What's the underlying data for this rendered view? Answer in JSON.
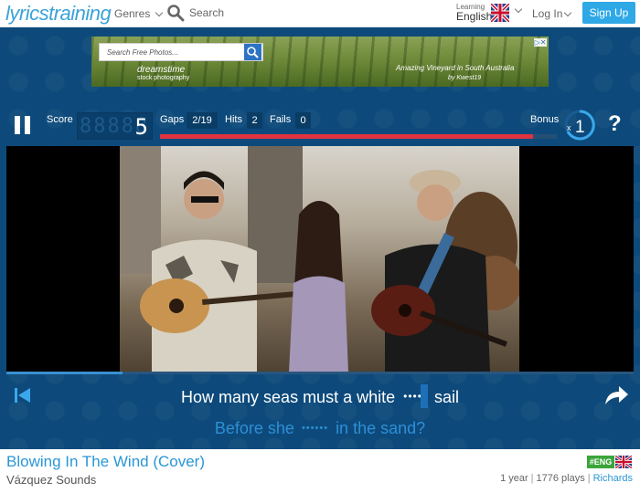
{
  "header": {
    "logo": "lyricstraining",
    "genres_label": "Genres",
    "search_label": "Search",
    "learning_label": "Learning",
    "language": "English",
    "login_label": "Log In",
    "signup_label": "Sign Up"
  },
  "ad": {
    "search_placeholder": "Search Free Photos...",
    "brand": "dreamstime",
    "brand_sub": "stock photography",
    "caption": "Amazing Vineyard in South Australia",
    "credit": "by Kwest19"
  },
  "scoreboard": {
    "score_label": "Score",
    "score_placeholder": "88888",
    "score_value": "5",
    "gaps_label": "Gaps",
    "gaps_value": "2/19",
    "hits_label": "Hits",
    "hits_value": "2",
    "fails_label": "Fails",
    "fails_value": "0",
    "bonus_label": "Bonus",
    "bonus_multiplier": "1",
    "bonus_prefix": "x",
    "help": "?",
    "progress_fraction": 0.94
  },
  "video": {
    "seek_fraction": 0.185
  },
  "lyrics": {
    "current_before": "How many seas must a white",
    "current_gap": "••••",
    "current_after": "sail",
    "next_before": "Before she",
    "next_gap": "••••••",
    "next_after": "in the sand?"
  },
  "song": {
    "title": "Blowing In The Wind (Cover)",
    "artist": "Vázquez Sounds",
    "language_badge": "#ENG",
    "age": "1 year",
    "plays": "1776 plays",
    "author": "Richards"
  },
  "colors": {
    "brand_blue": "#2fa8e6",
    "panel_blue": "#0d4a7b",
    "progress_red": "#e03240",
    "lyric_next": "#2e8fd6"
  }
}
